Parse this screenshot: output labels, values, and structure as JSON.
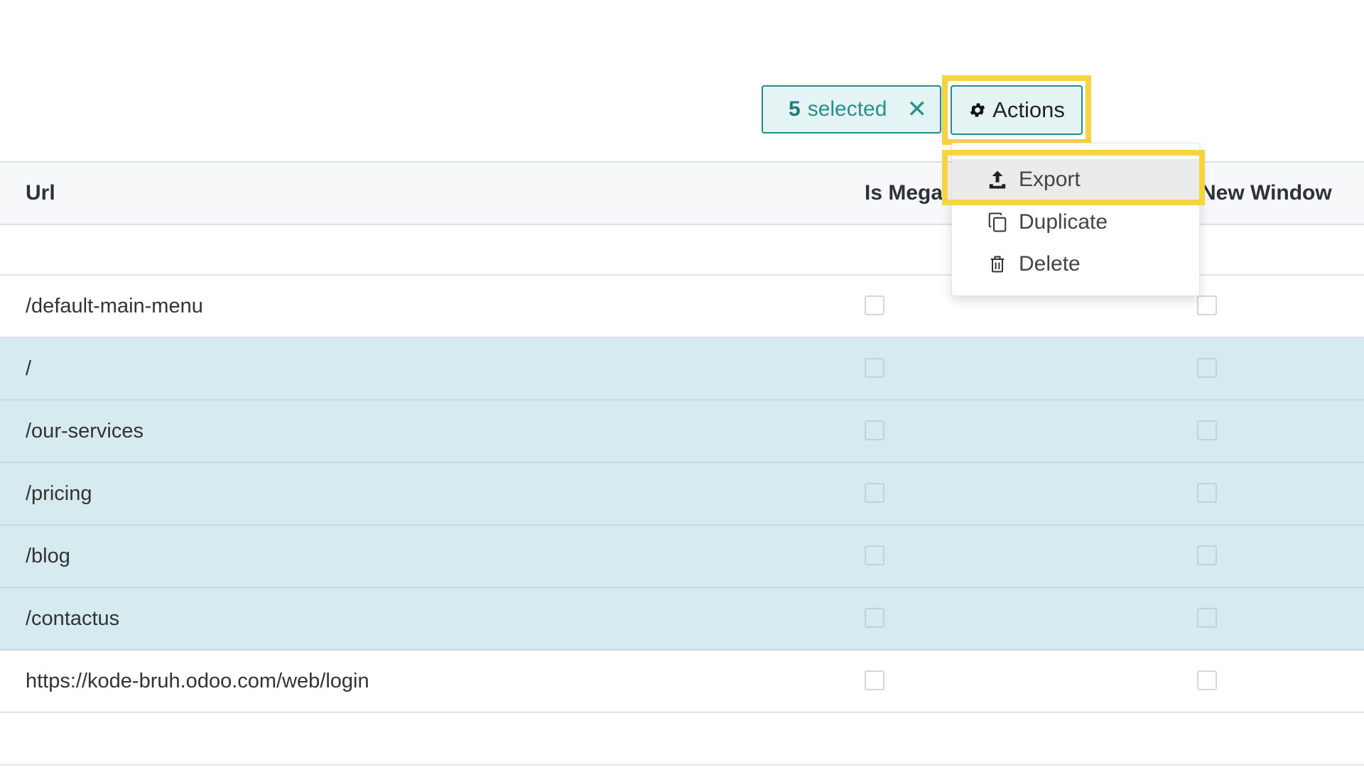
{
  "selection": {
    "count": "5",
    "label": "selected",
    "clear_icon": "close-x-icon"
  },
  "actions": {
    "label": "Actions",
    "icon": "gear-icon",
    "menu": [
      {
        "label": "Export",
        "icon": "upload-icon",
        "highlighted": true
      },
      {
        "label": "Duplicate",
        "icon": "copy-icon"
      },
      {
        "label": "Delete",
        "icon": "trash-icon"
      }
    ]
  },
  "table": {
    "columns": {
      "url": "Url",
      "is_mega": "Is Mega",
      "new_window": "New Window"
    },
    "rows": [
      {
        "url": "/default-main-menu",
        "selected": false
      },
      {
        "url": "/",
        "selected": true
      },
      {
        "url": "/our-services",
        "selected": true
      },
      {
        "url": "/pricing",
        "selected": true
      },
      {
        "url": "/blog",
        "selected": true
      },
      {
        "url": "/contactus",
        "selected": true
      },
      {
        "url": "https://kode-bruh.odoo.com/web/login",
        "selected": false
      }
    ]
  },
  "colors": {
    "accent": "#1f8f8a",
    "selected_row": "#d5ebf0",
    "highlight": "#f5d442"
  }
}
